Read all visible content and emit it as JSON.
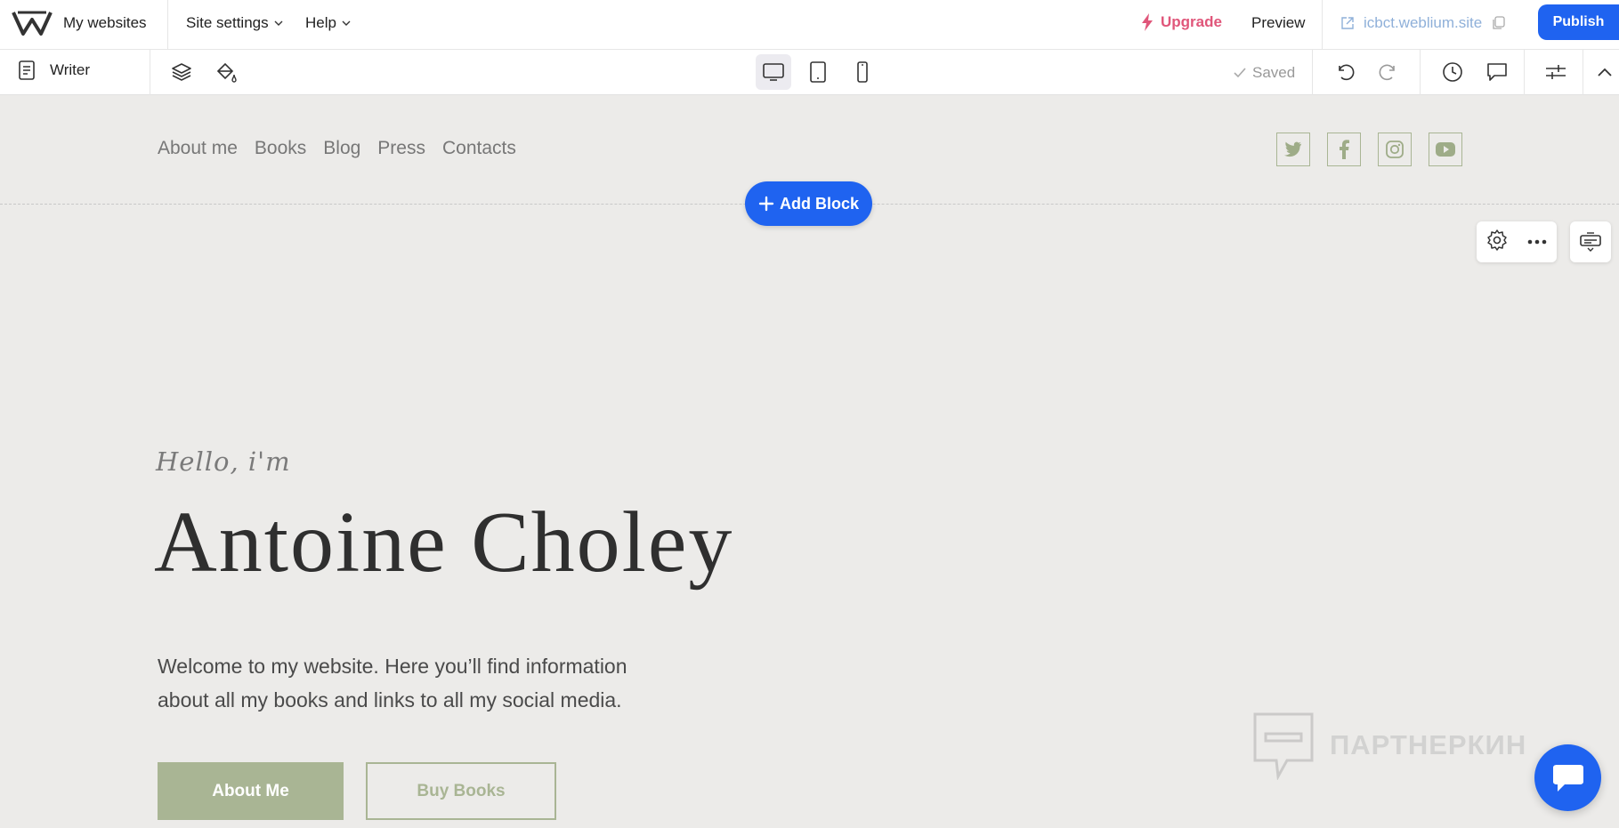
{
  "topbar": {
    "my_websites": "My websites",
    "site_settings": "Site settings",
    "help": "Help",
    "upgrade": "Upgrade",
    "preview": "Preview",
    "site_url": "icbct.weblium.site",
    "publish": "Publish"
  },
  "toolbar": {
    "page_name": "Writer",
    "saved": "Saved",
    "active_device": "desktop"
  },
  "site": {
    "nav": [
      "About me",
      "Books",
      "Blog",
      "Press",
      "Contacts"
    ],
    "socials": [
      "twitter-icon",
      "facebook-icon",
      "instagram-icon",
      "youtube-icon"
    ],
    "add_block": "Add Block",
    "greeting": "Hello, i'm",
    "name": "Antoine Choley",
    "intro": "Welcome to my website. Here you’ll find information about all my books and links to all my social media.",
    "primary_button": "About Me",
    "secondary_button": "Buy Books"
  },
  "watermark": "ПАРТНЕРКИН",
  "colors": {
    "accent": "#1f63f0",
    "upgrade": "#e0567a",
    "sage": "#a9b594",
    "canvas_bg": "#ecebe9"
  }
}
